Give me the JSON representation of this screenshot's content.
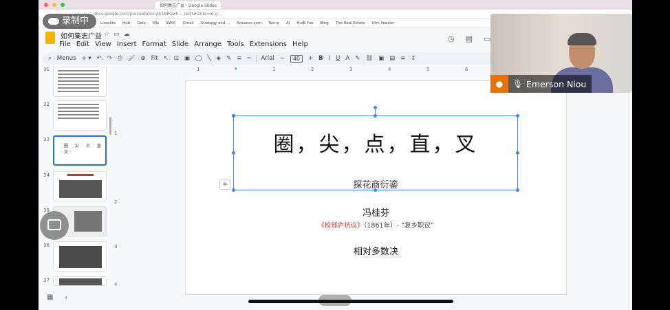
{
  "recording": {
    "label": "录制中"
  },
  "browser": {
    "tab_title": "如何集志广益 - Google Slides",
    "url": "docs.google.com/presentation/d/1BPGwh-.../edit#slide=id.g...",
    "bookmarks": [
      "Llorelite",
      "Hub",
      "Gelo",
      "Mix",
      "SWIC",
      "Gmail",
      "Strategy and ...",
      "Amazon.com",
      "Tecno",
      "AI",
      "HuiB Yue",
      "Bing",
      "The Real Estate",
      "Ulm Ileesler"
    ]
  },
  "docs": {
    "title": "如何集志广益",
    "menu": [
      "File",
      "Edit",
      "View",
      "Insert",
      "Format",
      "Slide",
      "Arrange",
      "Tools",
      "Extensions",
      "Help"
    ]
  },
  "toolbar": {
    "menus_label": "Menus",
    "fit_label": "Fit",
    "font": "Arial",
    "size": "40"
  },
  "ruler": {
    "h": [
      "1",
      "1",
      "2",
      "3",
      "4",
      "5",
      "6"
    ],
    "v": [
      "1",
      "2",
      "3",
      "4"
    ]
  },
  "filmstrip": {
    "slides": [
      {
        "num": "31"
      },
      {
        "num": "32"
      },
      {
        "num": "33",
        "mini": "圈 尖 点 直 叉"
      },
      {
        "num": "34"
      },
      {
        "num": "35"
      },
      {
        "num": "36"
      },
      {
        "num": "37"
      }
    ]
  },
  "slide": {
    "title": "圈，尖，点，直，叉",
    "subtitle": "探花商衍鎏",
    "author": "冯桂芬",
    "citation_book": "《校邠庐抗议》",
    "citation_rest": "（1861年）- “复乡职议”",
    "closing": "相对多数决"
  },
  "participant": {
    "name": "Emerson Niou"
  },
  "icons": [
    "cloud-icon",
    "user-icon",
    "mic-icon",
    "chat-icon",
    "grid-icon",
    "chevron-left-icon",
    "history-icon",
    "comment-icon"
  ]
}
